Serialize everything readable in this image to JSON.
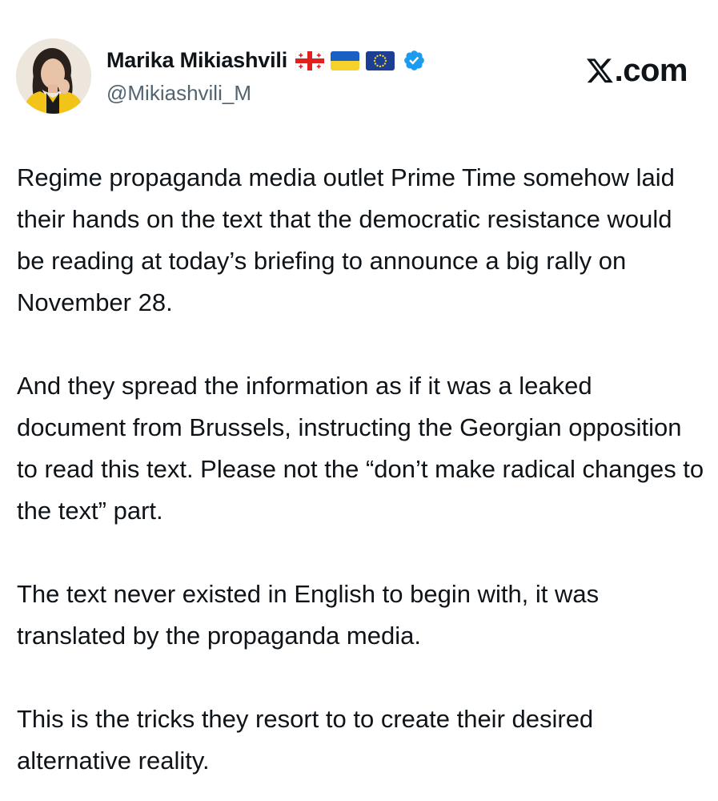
{
  "author": {
    "display_name": "Marika Mikiashvili",
    "handle": "@Mikiashvili_M",
    "flags": [
      "georgia-flag",
      "ukraine-flag",
      "eu-flag"
    ],
    "verified_icon": "verified-badge-icon",
    "verified_color": "#1d9bf0"
  },
  "brand": {
    "logo_icon": "x-logo-icon",
    "label": ".com"
  },
  "post": {
    "paragraphs": [
      "Regime propaganda media outlet Prime Time somehow laid their hands on the text that the democratic resistance would be reading at today’s briefing to announce a big rally on November 28.",
      "And they spread the information as if it was a leaked document from Brussels, instructing the Georgian opposition to read this text. Please not the “don’t make radical changes to the text” part.",
      "The text never existed in English to begin with, it was translated by the propaganda media.",
      "This is the tricks they resort to to create their desired alternative reality."
    ]
  },
  "colors": {
    "text": "#0f1419",
    "secondary_text": "#536471",
    "background": "#ffffff"
  }
}
